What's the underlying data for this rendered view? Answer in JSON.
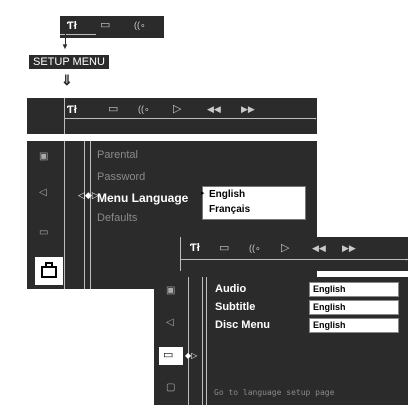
{
  "icons": {
    "setup": "setup-icon",
    "subtitle": "subtitle-icon",
    "audio": "audio-icon",
    "play": "play-icon",
    "rewind": "rewind-icon",
    "forward": "fast-forward-icon",
    "parental": "parental-icon",
    "speaker": "speaker-icon",
    "language": "language-icon",
    "general": "general-icon"
  },
  "glyphs": {
    "setup": "Ƭł",
    "subtitle": "▭",
    "audio": "((∘",
    "play": "▷",
    "rewind": "◀◀",
    "forward": "▶▶",
    "parental": "▣",
    "speaker": "◁",
    "language": "▭",
    "general": "▢",
    "down_arrow": "⇓"
  },
  "stage1": {
    "label": "SETUP MENU"
  },
  "menu": {
    "items": [
      "Parental",
      "Password",
      "Menu Language",
      "Defaults"
    ],
    "selected_index": 2,
    "language_options": [
      "English",
      "Français"
    ]
  },
  "language_setup": {
    "rows": [
      {
        "label": "Audio",
        "value": "English"
      },
      {
        "label": "Subtitle",
        "value": "English"
      },
      {
        "label": "Disc Menu",
        "value": "English"
      }
    ],
    "status": "Go to language setup page"
  },
  "colors": {
    "panel": "#2b2b2b",
    "lines": "#bdbdbd",
    "text_dim": "#8a8a8a"
  }
}
